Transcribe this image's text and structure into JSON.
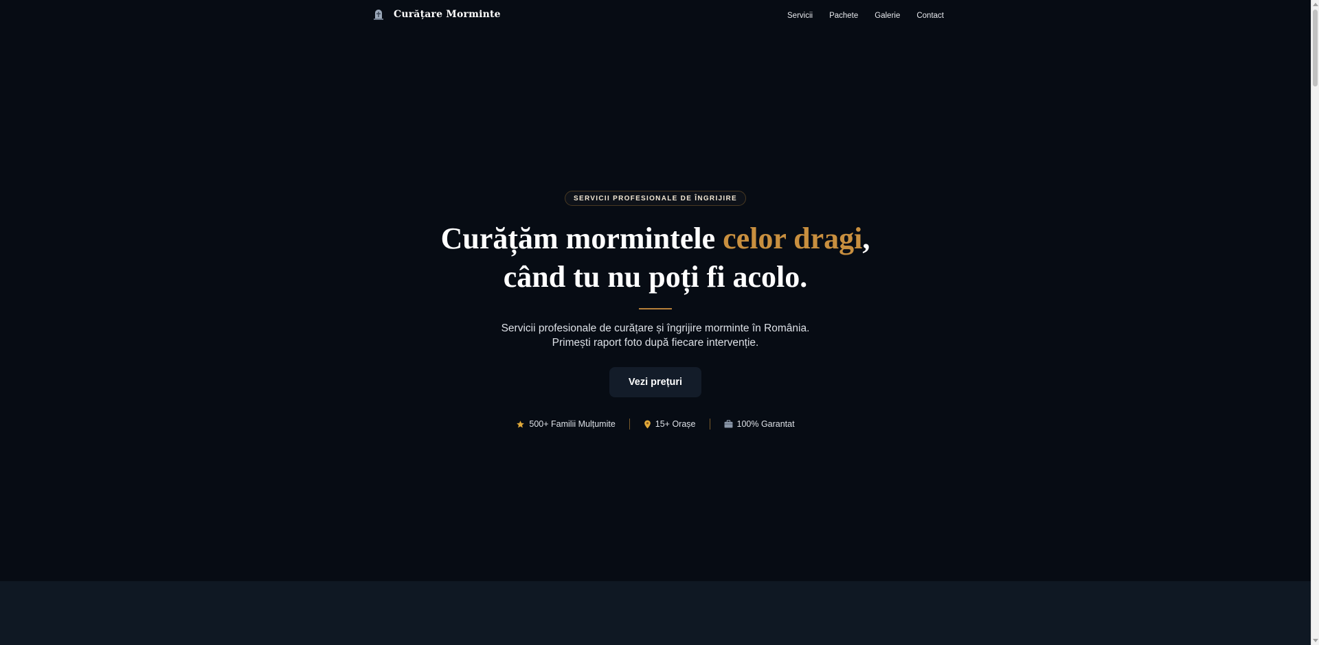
{
  "brand": {
    "name": "Curățare Morminte",
    "icon": "grave-icon"
  },
  "nav": {
    "items": [
      "Servicii",
      "Pachete",
      "Galerie",
      "Contact"
    ]
  },
  "hero": {
    "badge": "SERVICII PROFESIONALE DE ÎNGRIJIRE",
    "headline_part1": "Curățăm mormintele ",
    "headline_accent": "celor dragi",
    "headline_part2": ",",
    "headline_line2": "când tu nu poți fi acolo.",
    "subtitle_line1": "Servicii profesionale de curățare și îngrijire morminte în România.",
    "subtitle_line2": "Primești raport foto după fiecare intervenție.",
    "cta_label": "Vezi prețuri",
    "stats": [
      {
        "icon": "star-icon",
        "label": "500+ Familii Mulțumite"
      },
      {
        "icon": "location-pin-icon",
        "label": "15+ Orașe"
      },
      {
        "icon": "briefcase-icon",
        "label": "100% Garantat"
      }
    ]
  },
  "colors": {
    "background": "#070c14",
    "accent": "#c88f3f",
    "next_section": "#0f1823"
  }
}
